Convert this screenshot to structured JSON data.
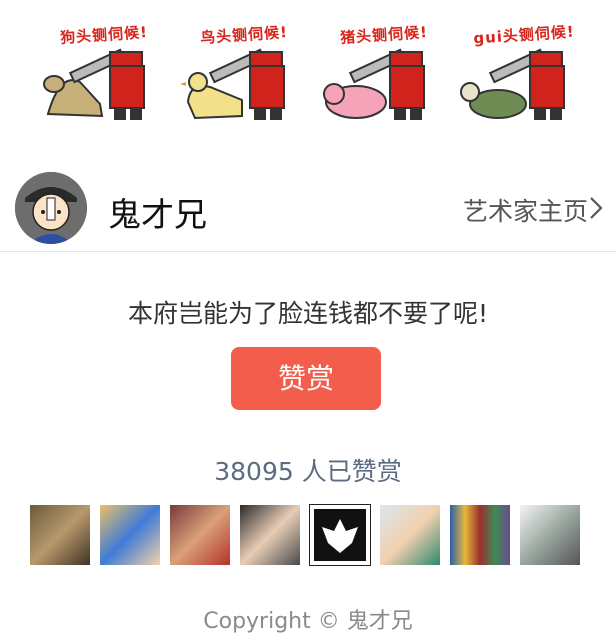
{
  "banner": {
    "stickers": [
      {
        "caption": "狗头铡伺候!",
        "animal": "dog",
        "color": "#c8b07a"
      },
      {
        "caption": "鸟头铡伺候!",
        "animal": "duck",
        "color": "#f2e08a"
      },
      {
        "caption": "猪头铡伺候!",
        "animal": "pig",
        "color": "#f4a3b8"
      },
      {
        "caption": "gui头铡伺候!",
        "animal": "turtle",
        "color": "#6f8c55"
      }
    ]
  },
  "author": {
    "name": "鬼才兄",
    "homepage_label": "艺术家主页",
    "chevron_icon": "chevron-right-icon"
  },
  "reward": {
    "message": "本府岂能为了脸连钱都不要了呢!",
    "button_label": "赞赏",
    "button_color": "#f25e4b",
    "count_text": "38095 人已赞赏"
  },
  "footer": {
    "copyright": "Copyright © 鬼才兄"
  }
}
